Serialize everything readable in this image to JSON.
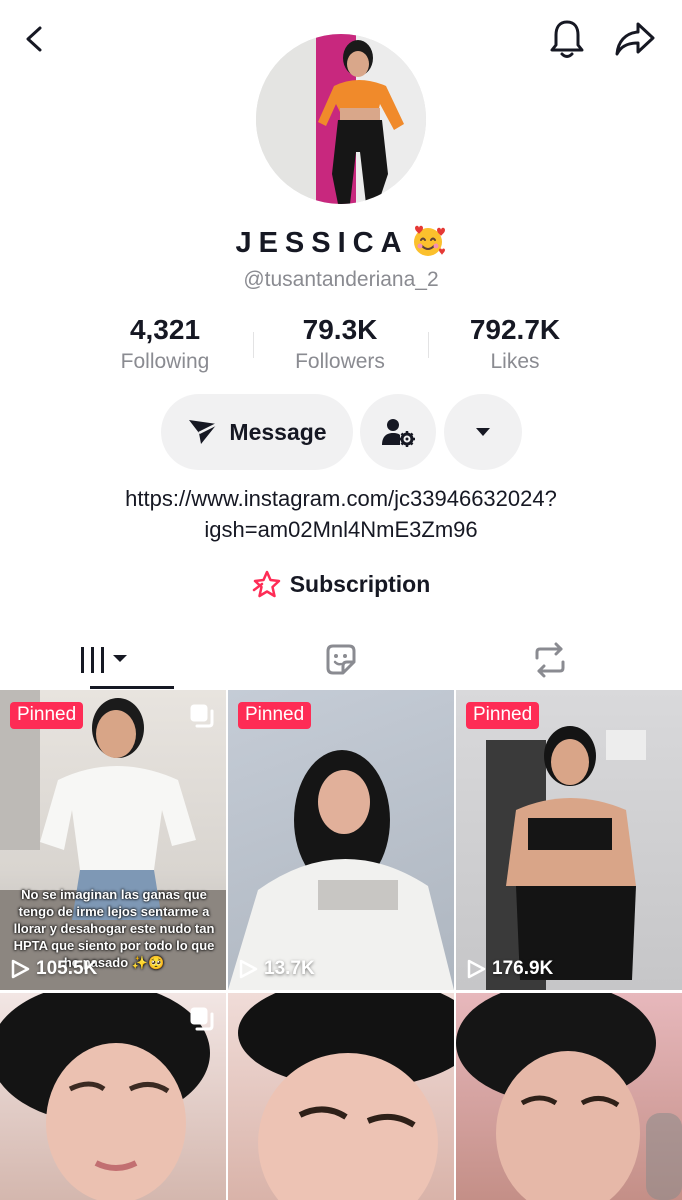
{
  "profile": {
    "display_name": "JESSICA",
    "username": "@tusantanderiana_2",
    "name_emoji": "smiling-face-with-hearts"
  },
  "stats": {
    "following": {
      "value": "4,321",
      "label": "Following"
    },
    "followers": {
      "value": "79.3K",
      "label": "Followers"
    },
    "likes": {
      "value": "792.7K",
      "label": "Likes"
    }
  },
  "actions": {
    "message_label": "Message"
  },
  "bio": {
    "link_line1": "https://www.instagram.com/jc33946632024?",
    "link_line2": "igsh=am02Mnl4NmE3Zm96"
  },
  "subscription": {
    "label": "Subscription"
  },
  "tabs": [
    {
      "name": "videos",
      "icon": "grid-icon",
      "active": true
    },
    {
      "name": "stickers",
      "icon": "sticker-icon",
      "active": false
    },
    {
      "name": "reposts",
      "icon": "repost-icon",
      "active": false
    }
  ],
  "videos": [
    {
      "pinned": "Pinned",
      "views": "105.5K",
      "multi": true,
      "caption": "No se imaginan las ganas que tengo de irme lejos sentarme a llorar y desahogar este nudo tan HPTA que siento por todo lo que he pasado ✨🥺"
    },
    {
      "pinned": "Pinned",
      "views": "13.7K",
      "multi": false
    },
    {
      "pinned": "Pinned",
      "views": "176.9K",
      "multi": false
    },
    {
      "pinned": "",
      "views": "",
      "multi": true
    },
    {
      "pinned": "",
      "views": "",
      "multi": false
    },
    {
      "pinned": "",
      "views": "",
      "multi": false
    }
  ],
  "colors": {
    "accent": "#fe2c55",
    "text_primary": "#161823",
    "text_secondary": "#8a8b91",
    "pill_bg": "#f1f1f2"
  }
}
